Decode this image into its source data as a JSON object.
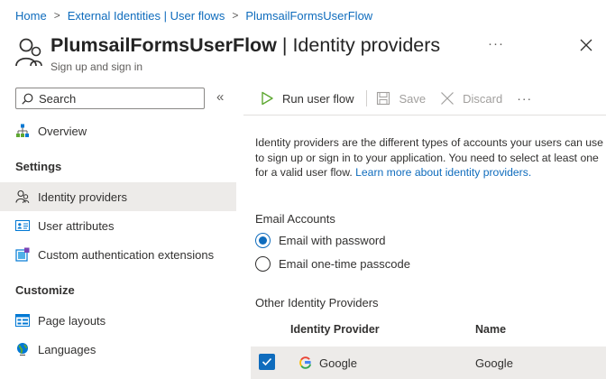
{
  "breadcrumb": {
    "items": [
      "Home",
      "External Identities | User flows",
      "PlumsailFormsUserFlow"
    ]
  },
  "header": {
    "title_bold": "PlumsailFormsUserFlow",
    "title_rest": " | Identity providers",
    "subtitle": "Sign up and sign in",
    "more": "···"
  },
  "sidebar": {
    "search_placeholder": "Search",
    "collapse": "«",
    "overview": "Overview",
    "settings_heading": "Settings",
    "settings_items": [
      "Identity providers",
      "User attributes",
      "Custom authentication extensions"
    ],
    "customize_heading": "Customize",
    "customize_items": [
      "Page layouts",
      "Languages"
    ]
  },
  "toolbar": {
    "run": "Run user flow",
    "save": "Save",
    "discard": "Discard",
    "more": "···"
  },
  "content": {
    "description": "Identity providers are the different types of accounts your users can use to sign up or sign in to your application. You need to select at least one for a valid user flow.",
    "learn_more": "Learn more about identity providers.",
    "email_accounts_label": "Email Accounts",
    "email_options": [
      "Email with password",
      "Email one-time passcode"
    ],
    "email_selected": "Email with password",
    "other_providers_label": "Other Identity Providers",
    "table": {
      "columns": [
        "Identity Provider",
        "Name"
      ],
      "rows": [
        {
          "provider": "Google",
          "name": "Google",
          "checked": true
        }
      ]
    }
  },
  "colors": {
    "accent": "#0f6cbd",
    "selected_bg": "#edebe9"
  }
}
